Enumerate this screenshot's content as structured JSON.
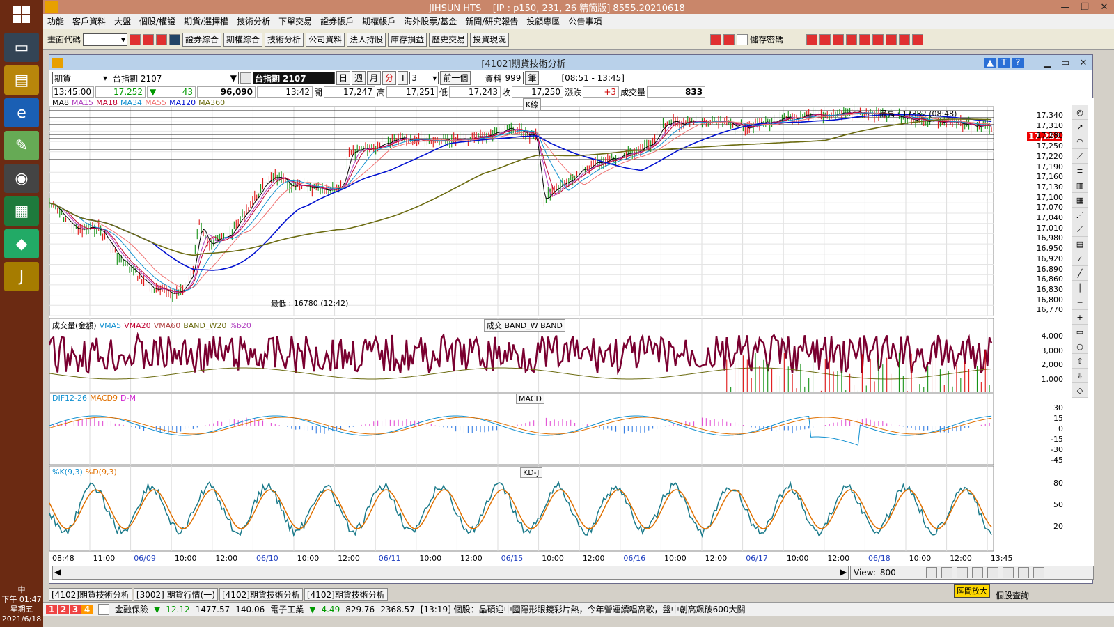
{
  "window": {
    "title": "JIHSUN HTS",
    "subtitle": "[IP : p150, 231, 26 精簡版] 8555.20210618"
  },
  "menu": [
    "功能",
    "客戶資料",
    "大盤",
    "個股/權證",
    "期貨/選擇權",
    "技術分析",
    "下單交易",
    "證券帳戶",
    "期權帳戶",
    "海外股票/基金",
    "新聞/研究報告",
    "投顧專區",
    "公告事項"
  ],
  "toolbar": {
    "code_label": "畫面代碼",
    "buttons": [
      "證券綜合",
      "期權綜合",
      "技術分析",
      "公司資料",
      "法人持股",
      "庫存損益",
      "歷史交易",
      "投資現況"
    ],
    "save_pwd": "儲存密碼"
  },
  "subwindow": {
    "title": "[4102]期貨技術分析"
  },
  "row1": {
    "type": "期貨",
    "product": "台指期 2107",
    "product_display": "台指期 2107",
    "day": "日",
    "week": "週",
    "month": "月",
    "min": "分",
    "tick": "T",
    "period": "3",
    "prev": "前一個",
    "data_label": "資料",
    "data_value": "999",
    "unit": "筆",
    "session": "[08:51 - 13:45]"
  },
  "row2": {
    "time": "13:45:00",
    "price": "17,252",
    "chg": "43",
    "vol": "96,090",
    "t2": "13:42",
    "open_l": "開",
    "open": "17,247",
    "high_l": "高",
    "high": "17,251",
    "low_l": "低",
    "low": "17,243",
    "close_l": "收",
    "close": "17,250",
    "diff_l": "漲跌",
    "diff": "+3",
    "vol_l": "成交量",
    "volv": "833"
  },
  "kline": {
    "label": "K線",
    "ma_legend": [
      "MA8",
      "MA15",
      "MA18",
      "MA34",
      "MA55",
      "MA120",
      "MA360"
    ],
    "max_text": "最高 : 17332 (08:48)",
    "min_text": "最低 : 16780 (12:42)",
    "current": "17,252",
    "y_ticks": [
      "17,340",
      "17,310",
      "17,280",
      "17,250",
      "17,220",
      "17,190",
      "17,160",
      "17,130",
      "17,100",
      "17,070",
      "17,040",
      "17,010",
      "16,980",
      "16,950",
      "16,920",
      "16,890",
      "16,860",
      "16,830",
      "16,800",
      "16,770"
    ]
  },
  "volume": {
    "legend": [
      "成交量(金額)",
      "VMA5",
      "VMA20",
      "VMA60",
      "BAND_W20",
      "%b20"
    ],
    "label": "成交   BAND_W   BAND",
    "y_ticks": [
      "4,000",
      "3,000",
      "2,000",
      "1,000"
    ]
  },
  "macd": {
    "legend": [
      "DIF12-26",
      "MACD9",
      "D-M"
    ],
    "label": "MACD",
    "y_ticks": [
      "30",
      "15",
      "0",
      "-15",
      "-30",
      "-45"
    ]
  },
  "kd": {
    "legend": [
      "%K(9,3)",
      "%D(9,3)"
    ],
    "label": "KD-J",
    "y_ticks": [
      "80",
      "50",
      "20"
    ]
  },
  "x_labels": [
    "08:48",
    "11:00",
    "06/09",
    "10:00",
    "12:00",
    "06/10",
    "10:00",
    "12:00",
    "06/11",
    "10:00",
    "12:00",
    "06/15",
    "10:00",
    "12:00",
    "06/16",
    "10:00",
    "12:00",
    "06/17",
    "10:00",
    "12:00",
    "06/18",
    "10:00",
    "12:00",
    "13:45"
  ],
  "view": {
    "label": "View:",
    "value": "800"
  },
  "tabs": [
    "[4102]期貨技術分析",
    "[3002] 期貨行情(一)",
    "[4102]期貨技術分析",
    "[4102]期貨技術分析"
  ],
  "status": {
    "nums": [
      "1",
      "2",
      "3",
      "4"
    ],
    "s1": "金融保險",
    "s1v": "12.12",
    "s1p": "1477.57",
    "s1c": "140.06",
    "s2": "電子工業",
    "s2v": "4.49",
    "s2p": "829.76",
    "s2c": "2368.57",
    "news": "[13:19]  個股：晶碩迎中國隱形眼鏡彩片熱，今年營運續唱高歌，盤中創高飆破600大關"
  },
  "zoom": "區間放大",
  "stock_query": "個股查詢",
  "clock": {
    "time": "下午 01:47",
    "day": "星期五",
    "date": "2021/6/18",
    "ime": "中"
  },
  "colors": {
    "ma8": "#000000",
    "ma15": "#b040c0",
    "ma18": "#c00030",
    "ma34": "#1090d0",
    "ma55": "#f07070",
    "ma120": "#0010d0",
    "ma360": "#6b6b10",
    "vol": "#7a0030"
  }
}
